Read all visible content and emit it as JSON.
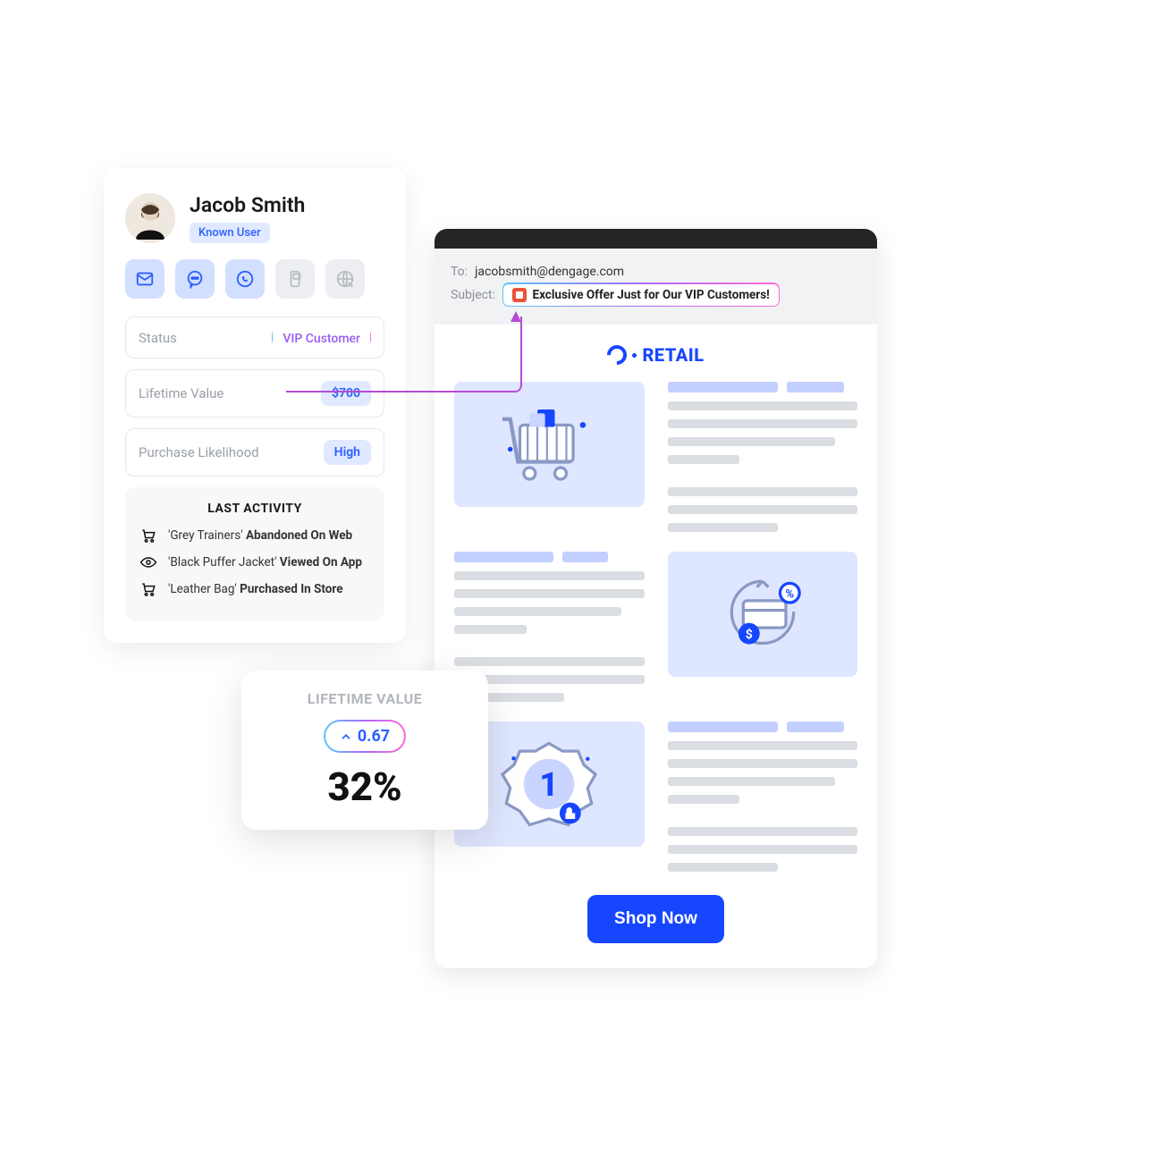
{
  "profile": {
    "name": "Jacob Smith",
    "tag": "Known User",
    "stats": {
      "status_label": "Status",
      "status_value": "VIP Customer",
      "ltv_label": "Lifetime Value",
      "ltv_value": "$700",
      "likelihood_label": "Purchase Likelihood",
      "likelihood_value": "High"
    },
    "activity": {
      "title": "LAST ACTIVITY",
      "items": [
        {
          "product": "'Grey Trainers'",
          "action": "Abandoned On Web"
        },
        {
          "product": "'Black Puffer Jacket'",
          "action": "Viewed On App"
        },
        {
          "product": "'Leather Bag'",
          "action": "Purchased In Store"
        }
      ]
    }
  },
  "ltv_card": {
    "title": "LIFETIME VALUE",
    "delta": "0.67",
    "percent": "32%"
  },
  "email": {
    "to_label": "To:",
    "to_value": "jacobsmith@dengage.com",
    "subject_label": "Subject:",
    "subject_value": "Exclusive Offer Just for Our VIP Customers!",
    "brand": "RETAIL",
    "cta": "Shop Now"
  }
}
